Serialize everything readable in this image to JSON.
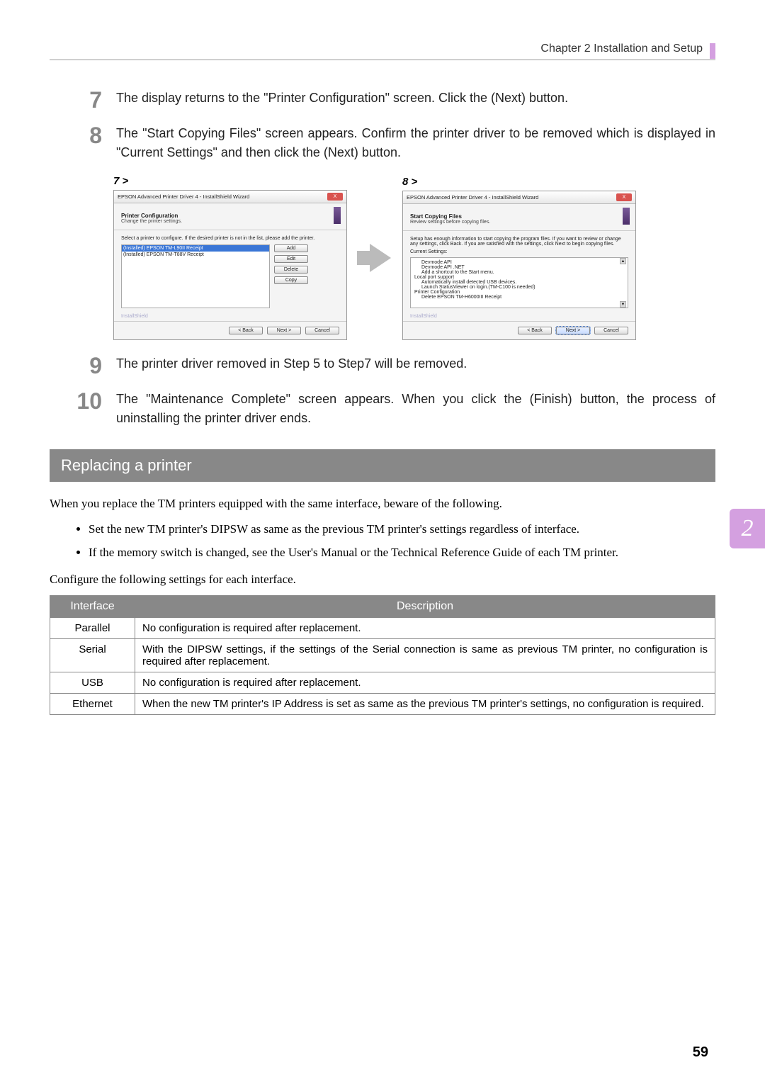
{
  "chapter": {
    "label": "Chapter 2   Installation and Setup"
  },
  "side_tab": "2",
  "steps": [
    {
      "num": "7",
      "text": "The display returns to the \"Printer Configuration\" screen. Click the (Next) button."
    },
    {
      "num": "8",
      "text": "The \"Start Copying Files\" screen appears. Confirm the printer driver to be removed which is displayed in \"Current Settings\" and then click the (Next) button."
    },
    {
      "num": "9",
      "text": "The printer driver removed in Step 5 to Step7 will be removed."
    },
    {
      "num": "10",
      "text": "The \"Maintenance Complete\" screen appears. When you click the (Finish) button, the process of uninstalling the printer driver ends."
    }
  ],
  "shot_labels": {
    "left": "7 >",
    "right": "8 >"
  },
  "win_left": {
    "title": "EPSON Advanced Printer Driver 4 - InstallShield Wizard",
    "close": "X",
    "band_title": "Printer Configuration",
    "band_sub": "Change the printer settings.",
    "instr": "Select a printer to configure. If the desired printer is not in the list, please add the printer.",
    "list": {
      "sel": "(Installed) EPSON TM-L90II Receipt",
      "item": "(Installed) EPSON TM-T88V Receipt"
    },
    "buttons": {
      "add": "Add",
      "edit": "Edit",
      "delete": "Delete",
      "copy": "Copy"
    },
    "ish": "InstallShield",
    "footer": {
      "back": "< Back",
      "next": "Next >",
      "cancel": "Cancel"
    }
  },
  "win_right": {
    "title": "EPSON Advanced Printer Driver 4 - InstallShield Wizard",
    "close": "X",
    "band_title": "Start Copying Files",
    "band_sub": "Review settings before copying files.",
    "para": "Setup has enough information to start copying the program files. If you want to review or change any settings, click Back. If you are satisfied with the settings, click Next to begin copying files.",
    "cur": "Current Settings:",
    "s1": "Devmode API",
    "s2": "Devmode API .NET",
    "s3": "Add a shortcut to the Start menu.",
    "s4": "Local port support",
    "s5": "Automatically install detected USB devices.",
    "s6": "Launch StatusViewer on login.(TM-C100 is needed)",
    "s7": "Printer Configuration",
    "s8": "Delete EPSON TM-H6000III Receipt",
    "ish": "InstallShield",
    "footer": {
      "back": "< Back",
      "next": "Next >",
      "cancel": "Cancel"
    }
  },
  "section_title": "Replacing a printer",
  "intro": "When you replace the TM printers equipped with the same interface, beware of the following.",
  "bullets": [
    "Set the new TM printer's DIPSW as same as the previous TM printer's settings regardless of interface.",
    "If the memory switch is changed, see the User's Manual or the Technical Reference Guide of each TM printer."
  ],
  "config_line": "Configure the following settings for each interface.",
  "table": {
    "headers": {
      "iface": "Interface",
      "desc": "Description"
    },
    "rows": [
      {
        "iface": "Parallel",
        "desc": "No configuration is required after replacement."
      },
      {
        "iface": "Serial",
        "desc": "With the DIPSW settings, if the settings of the Serial connection is same as previous TM printer, no configuration is required after replacement."
      },
      {
        "iface": "USB",
        "desc": "No configuration is required after replacement."
      },
      {
        "iface": "Ethernet",
        "desc": "When the new TM printer's IP Address is set as same as the previous TM printer's settings, no configuration is required."
      }
    ]
  },
  "page_number": "59"
}
